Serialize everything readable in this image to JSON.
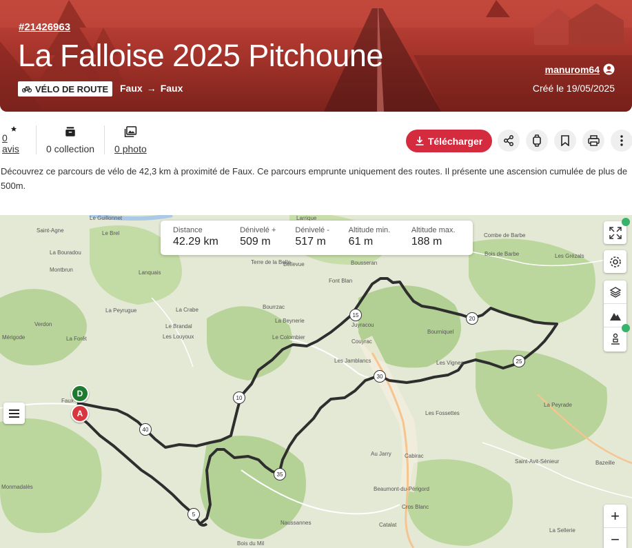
{
  "header": {
    "route_id": "#21426963",
    "title": "La Falloise 2025 Pitchoune",
    "activity_type": "VÉLO DE ROUTE",
    "start": "Faux",
    "end": "Faux",
    "author": "manurom64",
    "created": "Créé le 19/05/2025"
  },
  "actions": {
    "reviews": "0 avis",
    "collections": "0 collection",
    "photos": "0 photo",
    "download_label": "Télécharger"
  },
  "description": "Découvrez ce parcours de vélo de 42,3 km à proximité de Faux. Ce parcours emprunte uniquement des routes. Il présente une ascension cumulée de plus de 500m.",
  "map": {
    "stats": [
      {
        "label": "Distance",
        "value": "42.29 km"
      },
      {
        "label": "Dénivelé +",
        "value": "509 m"
      },
      {
        "label": "Dénivelé -",
        "value": "517 m"
      },
      {
        "label": "Altitude min.",
        "value": "61 m"
      },
      {
        "label": "Altitude max.",
        "value": "188 m"
      }
    ],
    "start_pin": "D",
    "end_pin": "A",
    "km_markers": [
      "5",
      "10",
      "15",
      "20",
      "25",
      "30",
      "35",
      "40"
    ],
    "places": [
      "Saint-Agne",
      "Le Brel",
      "La Bouradou",
      "Montbrun",
      "Lanquais",
      "La Peyrugue",
      "La Crabe",
      "Le Brandal",
      "Les Louyoux",
      "Verdon",
      "Mérigode",
      "La Forêt",
      "Faux",
      "Monmadalès",
      "Naussannes",
      "Bois du Mil",
      "Terre de la Belle",
      "Bellevue",
      "Bousseran",
      "Font Blan",
      "Bourrzac",
      "La Beynerie",
      "Le Colombier",
      "Couyrac",
      "Les Jamblancs",
      "Bourniquel",
      "Les Fossettes",
      "La Peyrade",
      "Cabirac",
      "Au Jarry",
      "Beaumont-du-Périgord",
      "Cros Blanc",
      "Catalat",
      "Saint-Avit-Sénieur",
      "Bazeille",
      "La Sellerie",
      "Combe de Barbe",
      "Bois de Barbe",
      "Les Grézals",
      "Le Guillonnet",
      "Larrique",
      "Juyracou",
      "Les Vignes"
    ],
    "zoom_in": "+",
    "zoom_out": "−"
  },
  "colors": {
    "hero_top": "#c1473b",
    "hero_bottom": "#7c221c",
    "download_button": "#d42b3f",
    "start_pin": "#1d7a2e",
    "end_pin": "#d8353f",
    "route_line": "#2e2e2e"
  }
}
